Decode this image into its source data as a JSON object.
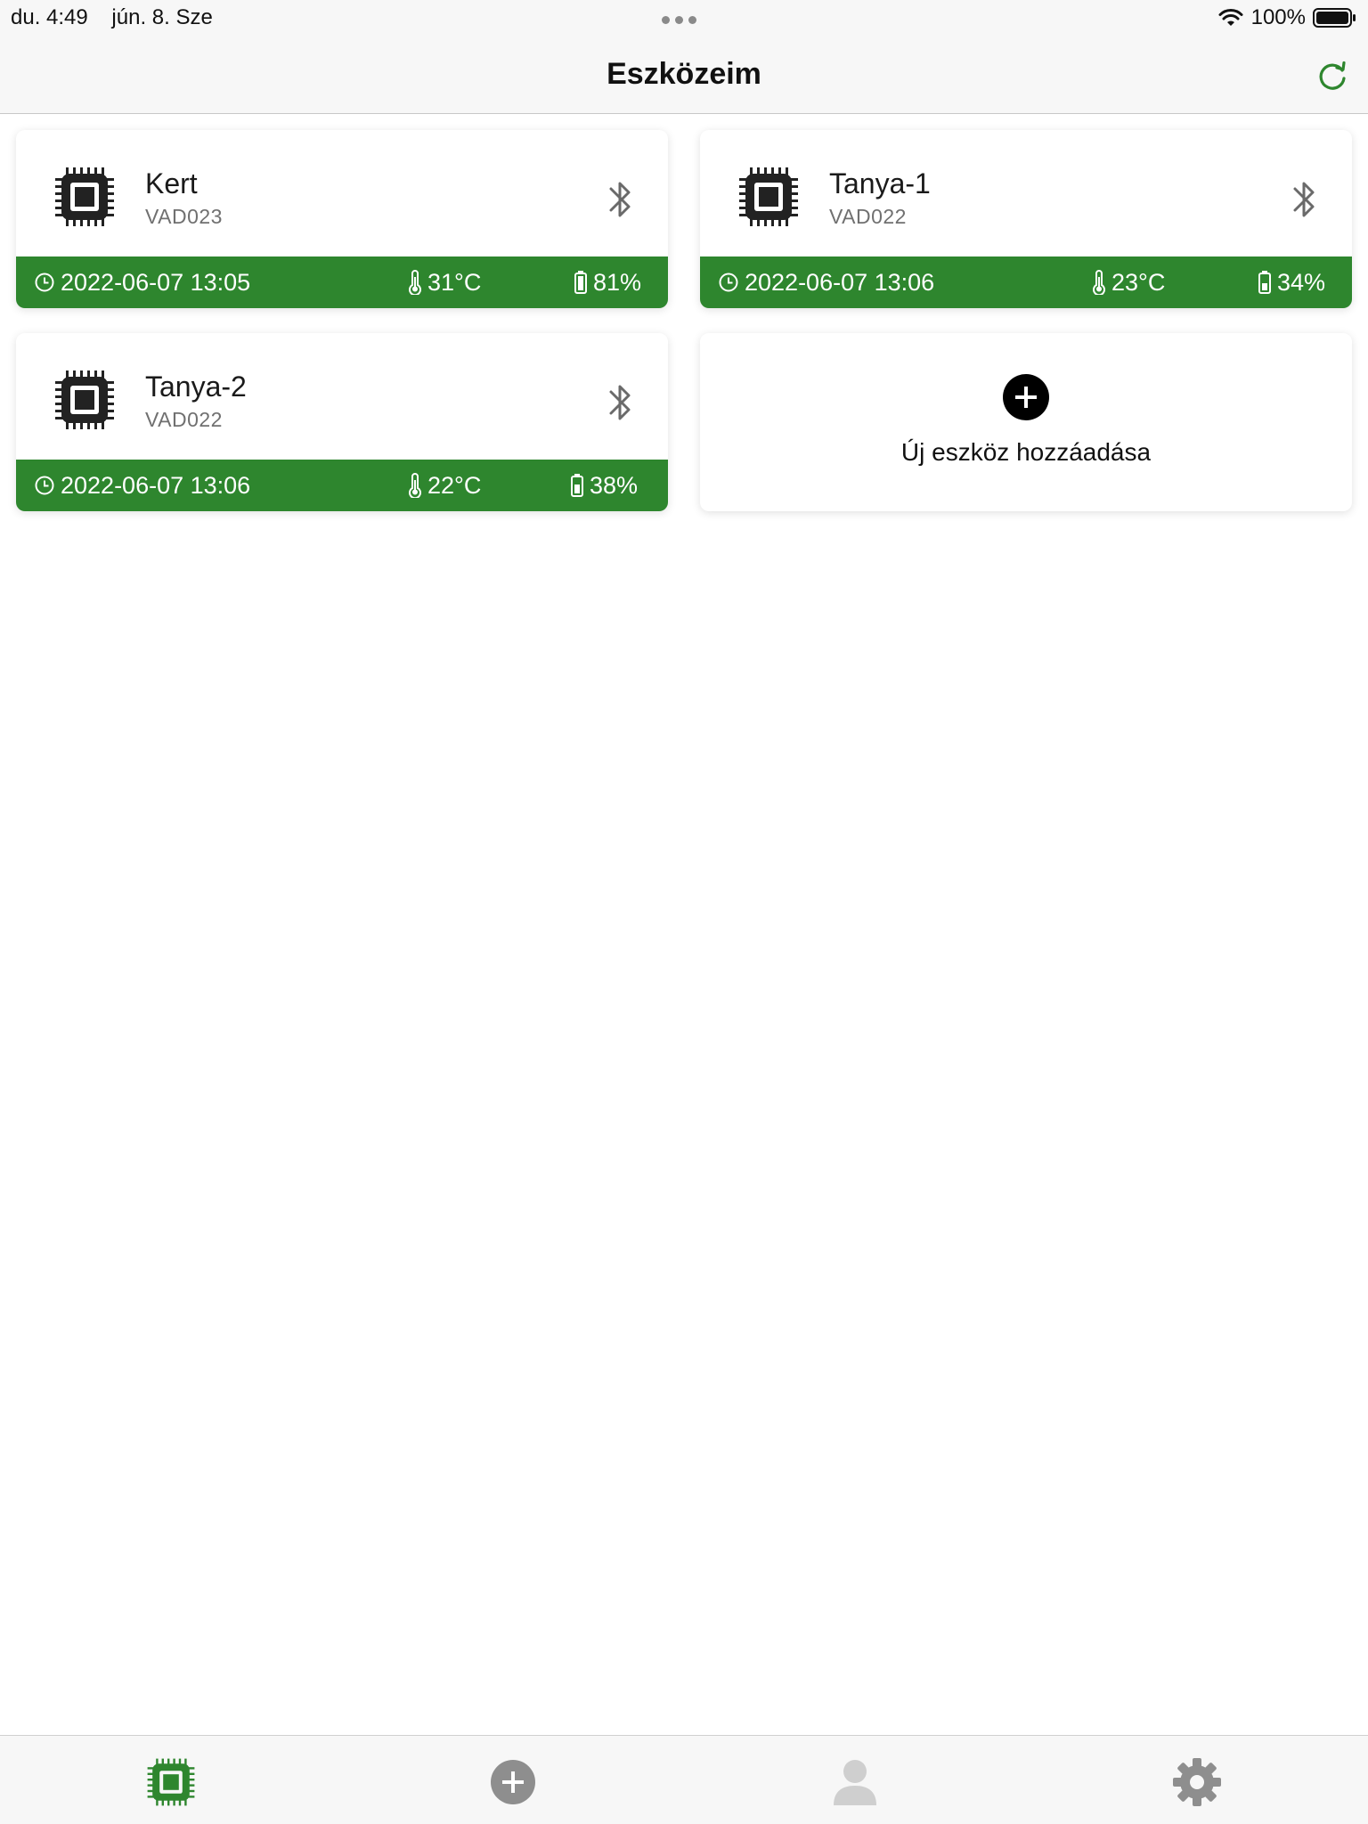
{
  "status_bar": {
    "time": "du. 4:49",
    "date": "jún. 8. Sze",
    "battery": "100%"
  },
  "nav": {
    "title": "Eszközeim",
    "refresh_icon": "refresh-icon",
    "accent_color": "#2e862e"
  },
  "devices": [
    {
      "name": "Kert",
      "id": "VAD023",
      "timestamp": "2022-06-07 13:05",
      "temperature": "31°C",
      "battery": "81%"
    },
    {
      "name": "Tanya-1",
      "id": "VAD022",
      "timestamp": "2022-06-07 13:06",
      "temperature": "23°C",
      "battery": "34%"
    },
    {
      "name": "Tanya-2",
      "id": "VAD022",
      "timestamp": "2022-06-07 13:06",
      "temperature": "22°C",
      "battery": "38%"
    }
  ],
  "add_card": {
    "label": "Új eszköz hozzáadása",
    "icon": "plus-circle-icon"
  },
  "tab_bar": {
    "tabs": [
      {
        "icon": "chip-icon",
        "active": true
      },
      {
        "icon": "plus-circle-icon",
        "active": false
      },
      {
        "icon": "person-icon",
        "active": false
      },
      {
        "icon": "gear-icon",
        "active": false
      }
    ]
  }
}
